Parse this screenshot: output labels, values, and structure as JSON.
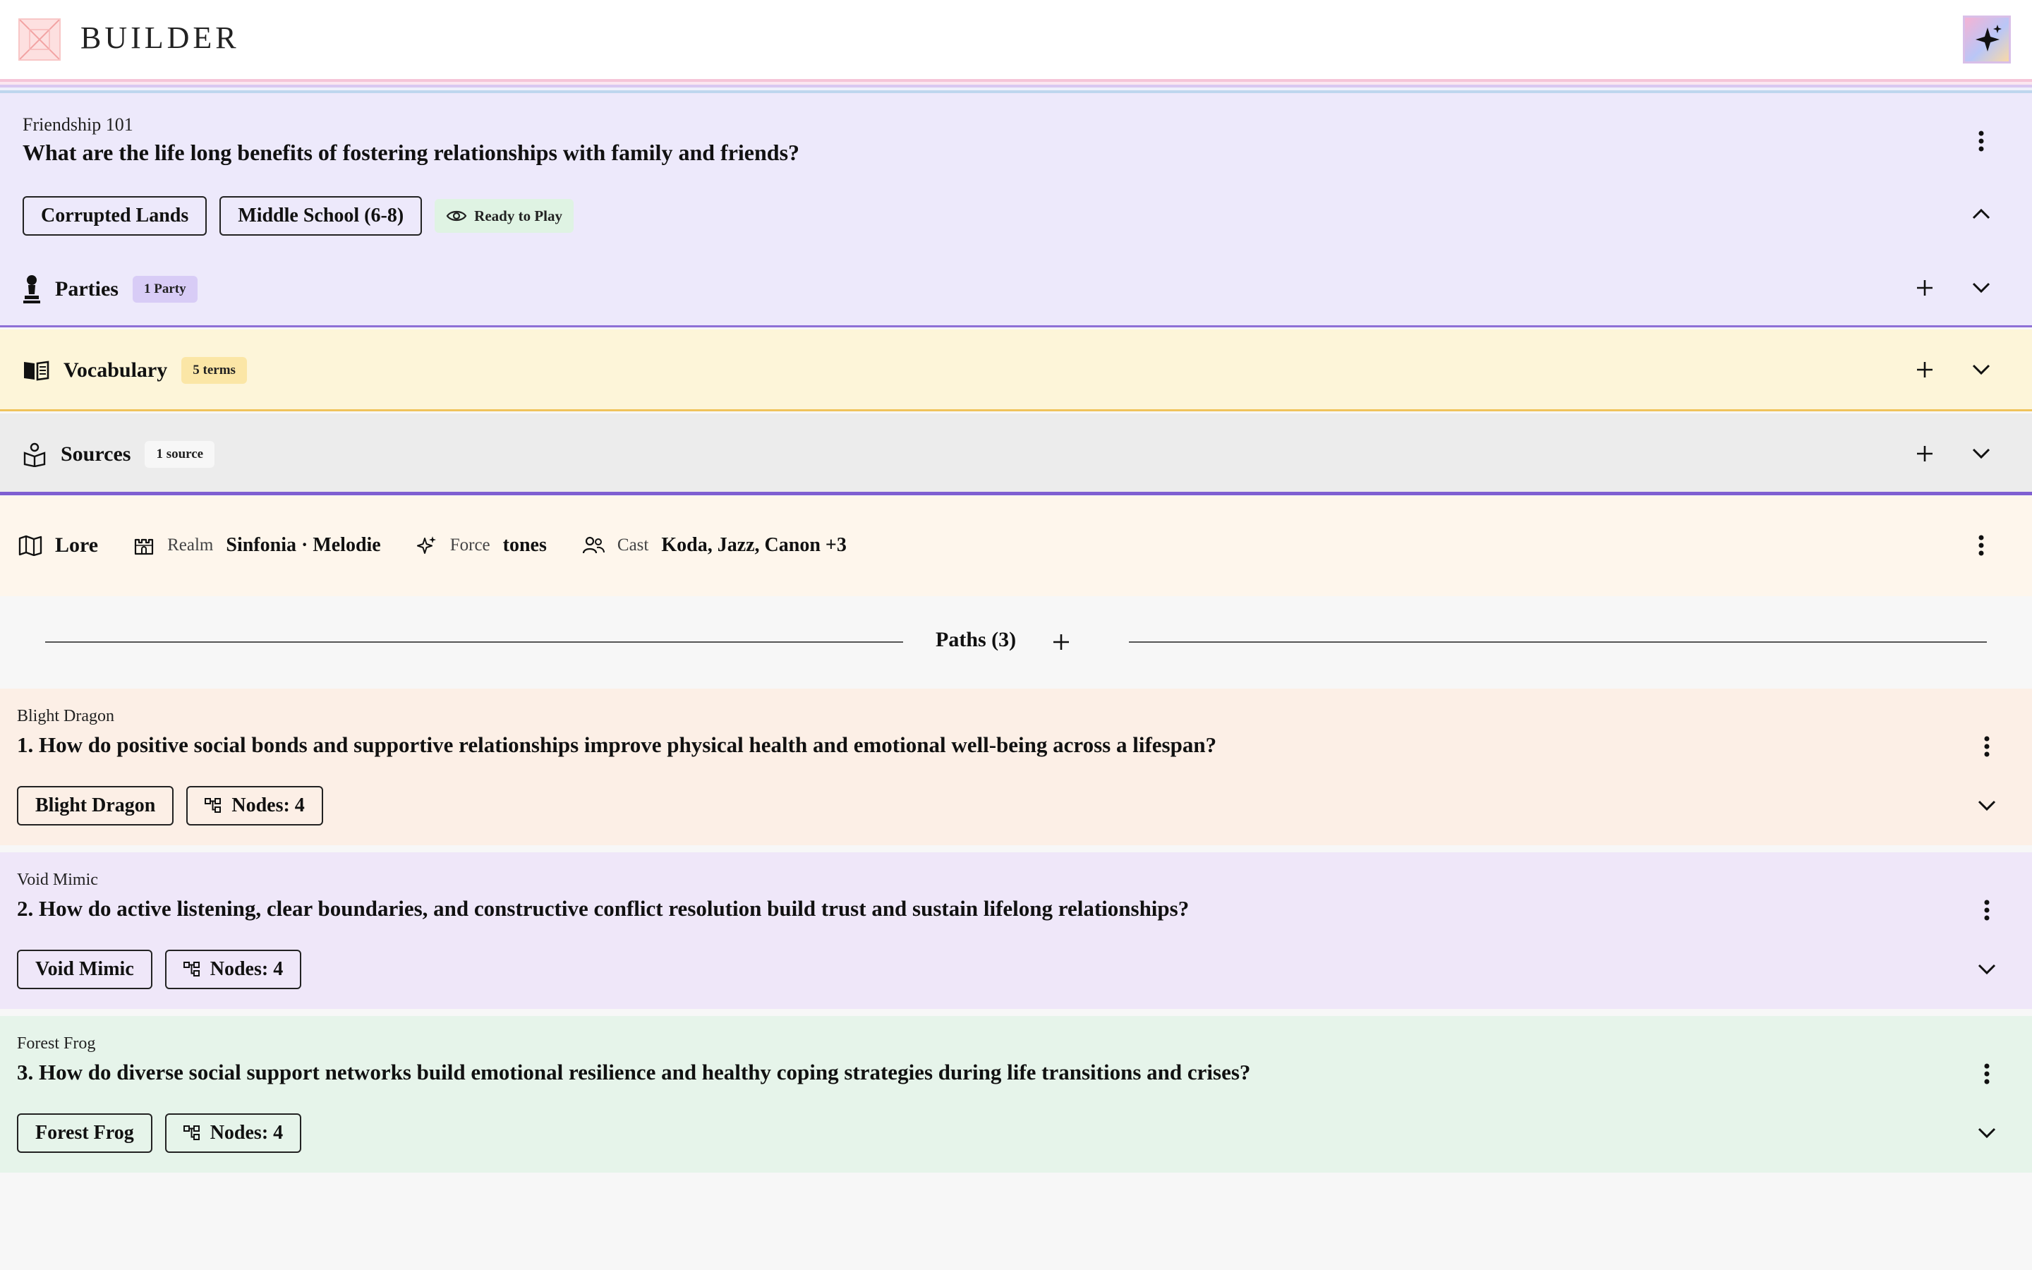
{
  "app": {
    "brand": "BUILDER"
  },
  "quest": {
    "course": "Friendship 101",
    "question": "What are the life long benefits of fostering relationships with family and friends?",
    "tags": [
      "Corrupted Lands",
      "Middle School (6-8)"
    ],
    "status": "Ready to Play"
  },
  "sections": {
    "parties": {
      "title": "Parties",
      "badge": "1 Party",
      "badge_color": "#d8ccf6"
    },
    "vocabulary": {
      "title": "Vocabulary",
      "badge": "5 terms",
      "badge_color": "#fbe6a6"
    },
    "sources": {
      "title": "Sources",
      "badge": "1 source",
      "badge_color": "#f7f7f7"
    }
  },
  "lore": {
    "title": "Lore",
    "realm_label": "Realm",
    "realm_value": "Sinfonia · Melodie",
    "force_label": "Force",
    "force_value": "tones",
    "cast_label": "Cast",
    "cast_value": "Koda, Jazz, Canon +3"
  },
  "paths": {
    "heading": "Paths (3)",
    "items": [
      {
        "name": "Blight Dragon",
        "question": "1. How do positive social bonds and supportive relationships improve physical health and emotional well-being across a lifespan?",
        "chip": "Blight Dragon",
        "nodes": "Nodes: 4",
        "bg": "#fcefe6"
      },
      {
        "name": "Void Mimic",
        "question": "2. How do active listening, clear boundaries, and constructive conflict resolution build trust and sustain lifelong relationships?",
        "chip": "Void Mimic",
        "nodes": "Nodes: 4",
        "bg": "#efe7f9"
      },
      {
        "name": "Forest Frog",
        "question": "3. How do diverse social support networks build emotional resilience and healthy coping strategies during life transitions and crises?",
        "chip": "Forest Frog",
        "nodes": "Nodes: 4",
        "bg": "#e6f4ea"
      }
    ]
  },
  "colors": {
    "stripe_pink": "#f7c9dc",
    "stripe_lavender": "#d9c9f2",
    "stripe_blue": "#bcd5ee"
  }
}
